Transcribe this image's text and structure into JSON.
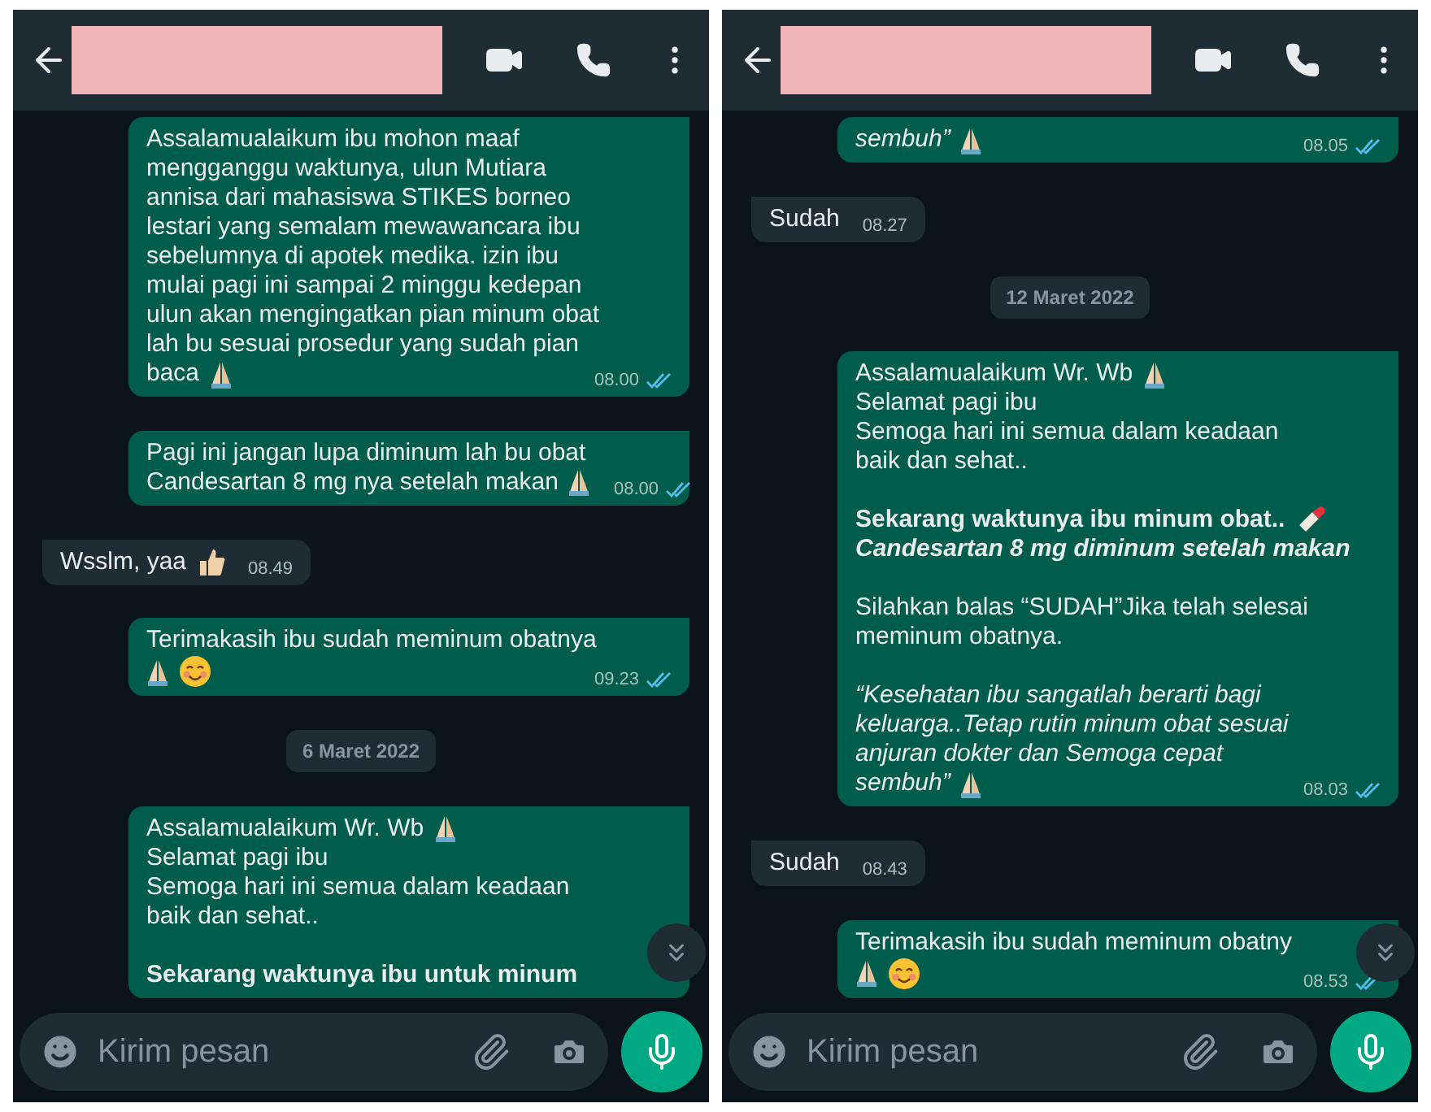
{
  "panels": [
    {
      "header": {
        "name_hidden": true
      },
      "messages": [
        {
          "kind": "sent",
          "time": "08.00",
          "read": true,
          "paragraphs": [
            [
              {
                "text": "Assalamualaikum ibu mohon maaf"
              },
              {
                "text": "mengganggu waktunya, ulun Mutiara"
              },
              {
                "text": "annisa dari mahasiswa STIKES borneo"
              },
              {
                "text": "lestari yang semalam mewawancara ibu"
              },
              {
                "text": "sebelumnya di apotek medika. izin ibu"
              },
              {
                "text": "mulai pagi ini sampai 2 minggu kedepan"
              },
              {
                "text": "ulun akan mengingatkan pian minum obat"
              },
              {
                "text": "lah bu sesuai prosedur yang sudah pian"
              },
              {
                "text": "baca",
                "emoji": [
                  {
                    "kind": "pray"
                  }
                ]
              }
            ]
          ]
        },
        {
          "kind": "sent",
          "time": "08.00",
          "read": true,
          "paragraphs": [
            [
              {
                "text": "Pagi ini jangan lupa diminum lah bu obat"
              },
              {
                "text": "Candesartan 8 mg nya setelah makan",
                "emoji": [
                  {
                    "kind": "pray"
                  }
                ]
              }
            ]
          ]
        },
        {
          "kind": "received",
          "time": "08.49",
          "paragraphs": [
            [
              {
                "text": "Wsslm, yaa",
                "emoji": [
                  {
                    "kind": "thumbs"
                  }
                ]
              }
            ]
          ]
        },
        {
          "kind": "sent",
          "time": "09.23",
          "read": true,
          "paragraphs": [
            [
              {
                "text": "Terimakasih ibu sudah meminum obatnya"
              },
              {
                "emoji": [
                  {
                    "kind": "pray"
                  },
                  {
                    "kind": "smile"
                  }
                ]
              }
            ]
          ]
        },
        {
          "kind": "date",
          "text": "6 Maret 2022"
        },
        {
          "kind": "sent",
          "paragraphs": [
            [
              {
                "text": "Assalamualaikum Wr. Wb",
                "emoji": [
                  {
                    "kind": "pray"
                  }
                ]
              },
              {
                "text": "Selamat pagi ibu"
              },
              {
                "text": "Semoga hari ini semua dalam keadaan"
              },
              {
                "text": "baik dan sehat.."
              }
            ],
            [
              {
                "text": "Sekarang waktunya ibu untuk minum",
                "kind": "bold"
              }
            ]
          ]
        }
      ],
      "scroll_button": true,
      "input": {
        "placeholder": "Kirim pesan"
      }
    },
    {
      "header": {
        "name_hidden": true
      },
      "messages": [
        {
          "kind": "sent",
          "time": "08.05",
          "read": true,
          "paragraphs": [
            [
              {
                "text": "sembuh”",
                "kind": "italic",
                "emoji": [
                  {
                    "kind": "pray"
                  }
                ]
              }
            ]
          ]
        },
        {
          "kind": "received",
          "time": "08.27",
          "paragraphs": [
            [
              {
                "text": "Sudah"
              }
            ]
          ]
        },
        {
          "kind": "date",
          "text": "12 Maret 2022"
        },
        {
          "kind": "sent",
          "time": "08.03",
          "read": true,
          "paragraphs": [
            [
              {
                "text": "Assalamualaikum Wr. Wb",
                "emoji": [
                  {
                    "kind": "pray"
                  }
                ]
              },
              {
                "text": "Selamat pagi ibu"
              },
              {
                "text": "Semoga hari ini semua dalam keadaan"
              },
              {
                "text": "baik dan sehat.."
              }
            ],
            [
              {
                "text": "Sekarang waktunya ibu minum obat..",
                "kind": "bold",
                "emoji": [
                  {
                    "kind": "pill"
                  }
                ]
              },
              {
                "text": "Candesartan 8 mg diminum setelah makan",
                "kind": "bold-italic"
              }
            ],
            [
              {
                "text": "Silahkan balas “SUDAH”Jika telah selesai"
              },
              {
                "text": "meminum obatnya."
              }
            ],
            [
              {
                "text": "“Kesehatan ibu sangatlah berarti bagi",
                "kind": "italic"
              },
              {
                "text": "keluarga..Tetap rutin minum obat sesuai",
                "kind": "italic"
              },
              {
                "text": "anjuran dokter dan Semoga cepat",
                "kind": "italic"
              },
              {
                "text": "sembuh”",
                "kind": "italic",
                "emoji": [
                  {
                    "kind": "pray"
                  }
                ]
              }
            ]
          ]
        },
        {
          "kind": "received",
          "time": "08.43",
          "paragraphs": [
            [
              {
                "text": "Sudah"
              }
            ]
          ]
        },
        {
          "kind": "sent",
          "time": "08.53",
          "read": true,
          "paragraphs": [
            [
              {
                "text": "Terimakasih ibu sudah meminum obatny"
              },
              {
                "emoji": [
                  {
                    "kind": "pray"
                  },
                  {
                    "kind": "smile"
                  }
                ]
              }
            ]
          ]
        }
      ],
      "scroll_button": true,
      "input": {
        "placeholder": "Kirim pesan"
      }
    }
  ]
}
